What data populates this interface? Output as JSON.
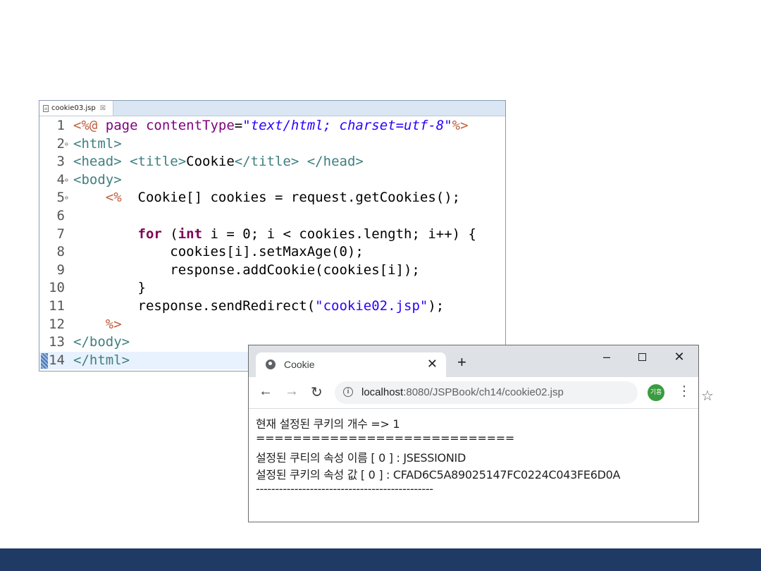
{
  "editor": {
    "tab_label": "cookie03.jsp",
    "tab_close": "☒",
    "lines": [
      {
        "num": "1",
        "fold": "",
        "tokens": [
          {
            "c": "t-dir",
            "t": "<%@ "
          },
          {
            "c": "t-attr",
            "t": "page contentType"
          },
          {
            "c": "t-plain",
            "t": "="
          },
          {
            "c": "t-str",
            "t": "\"text/html; charset=utf-8\""
          },
          {
            "c": "t-dir",
            "t": "%>"
          }
        ]
      },
      {
        "num": "2",
        "fold": "⊖",
        "tokens": [
          {
            "c": "t-tag",
            "t": "<html>"
          }
        ]
      },
      {
        "num": "3",
        "fold": "",
        "tokens": [
          {
            "c": "t-tag",
            "t": "<head> <title>"
          },
          {
            "c": "t-plain",
            "t": "Cookie"
          },
          {
            "c": "t-tag",
            "t": "</title> </head>"
          }
        ]
      },
      {
        "num": "4",
        "fold": "⊖",
        "tokens": [
          {
            "c": "t-tag",
            "t": "<body>"
          }
        ]
      },
      {
        "num": "5",
        "fold": "⊖",
        "tokens": [
          {
            "c": "t-plain",
            "t": "    "
          },
          {
            "c": "t-dir",
            "t": "<%"
          },
          {
            "c": "t-plain",
            "t": "  Cookie[] cookies = request.getCookies();"
          }
        ]
      },
      {
        "num": "6",
        "fold": "",
        "tokens": []
      },
      {
        "num": "7",
        "fold": "",
        "tokens": [
          {
            "c": "t-plain",
            "t": "        "
          },
          {
            "c": "t-kw",
            "t": "for"
          },
          {
            "c": "t-plain",
            "t": " ("
          },
          {
            "c": "t-kw",
            "t": "int"
          },
          {
            "c": "t-plain",
            "t": " i = 0; i < cookies.length; i++) {"
          }
        ]
      },
      {
        "num": "8",
        "fold": "",
        "tokens": [
          {
            "c": "t-plain",
            "t": "            cookies[i].setMaxAge(0);"
          }
        ]
      },
      {
        "num": "9",
        "fold": "",
        "tokens": [
          {
            "c": "t-plain",
            "t": "            response.addCookie(cookies[i]);"
          }
        ]
      },
      {
        "num": "10",
        "fold": "",
        "tokens": [
          {
            "c": "t-plain",
            "t": "        }"
          }
        ]
      },
      {
        "num": "11",
        "fold": "",
        "tokens": [
          {
            "c": "t-plain",
            "t": "        response.sendRedirect("
          },
          {
            "c": "t-jstr",
            "t": "\"cookie02.jsp\""
          },
          {
            "c": "t-plain",
            "t": ");"
          }
        ]
      },
      {
        "num": "12",
        "fold": "",
        "tokens": [
          {
            "c": "t-plain",
            "t": "    "
          },
          {
            "c": "t-dir",
            "t": "%>"
          }
        ]
      },
      {
        "num": "13",
        "fold": "",
        "tokens": [
          {
            "c": "t-tag",
            "t": "</body>"
          }
        ]
      },
      {
        "num": "14",
        "fold": "",
        "current": true,
        "tokens": [
          {
            "c": "t-tag",
            "t": "</html>"
          }
        ]
      }
    ]
  },
  "browser": {
    "tab_title": "Cookie",
    "tab_close": "✕",
    "new_tab": "+",
    "win_min": "–",
    "win_close": "✕",
    "nav_back": "←",
    "nav_forward": "→",
    "nav_reload": "↻",
    "info": "i",
    "url_host": "localhost",
    "url_path": ":8080/JSPBook/ch14/cookie02.jsp",
    "star": "☆",
    "avatar_text": "기흥",
    "menu": "⋮",
    "content_lines": [
      "현재 설정된 쿠키의 개수 => 1",
      "============================",
      "설정된 쿠티의 속성 이름 [ 0 ] : JSESSIONID",
      "설정된 쿠키의 속성 값 [ 0 ] : CFAD6C5A89025147FC0224C043FE6D0A",
      "----------------------------------------------"
    ]
  },
  "colors": {
    "footer_bar": "#1f3a65",
    "editor_tabbar": "#dae6f3",
    "current_line": "#e8f2fe",
    "avatar": "#3a9c3e"
  }
}
